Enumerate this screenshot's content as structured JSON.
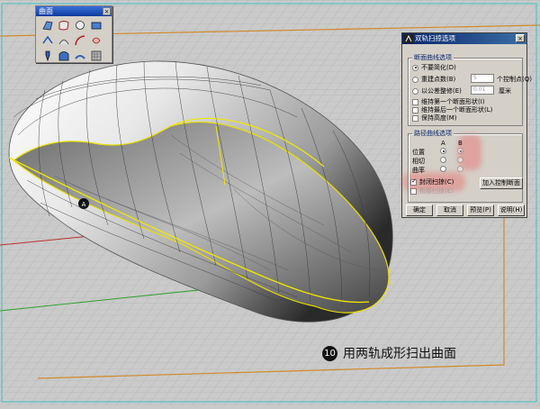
{
  "toolbar": {
    "title": "曲面",
    "icons": [
      "corner-points-surface-icon",
      "edge-curves-surface-icon",
      "planar-curves-surface-icon",
      "rectangle-plane-icon",
      "extrude-icon",
      "loft-icon",
      "sweep-rail-icon",
      "revolve-icon",
      "patch-icon",
      "network-surface-icon",
      "blend-icon",
      "drape-icon"
    ]
  },
  "dialog": {
    "title": "双轨扫掠选项",
    "section_cross": "断面曲线选项",
    "opt_no_simplify": "不要简化(D)",
    "opt_rebuild": "重建点数(B)",
    "rebuild_value": "5",
    "rebuild_unit": "个控制点(Q)",
    "opt_refit": "以公差整修(E)",
    "refit_value": "0.01",
    "refit_unit": "厘米",
    "chk_first": "维持第一个断面形状(I)",
    "chk_last": "维持最后一个断面形状(L)",
    "chk_height": "保持高度(M)",
    "section_path": "路径曲线选项",
    "col_a": "A",
    "col_b": "B",
    "row_position": "位置",
    "row_tangent": "相切",
    "row_curvature": "曲率",
    "chk_closed": "封闭扫掠(C)",
    "chk_seamless": "衔接扫掠(E)",
    "btn_add_section": "加入控制断面",
    "btn_ok": "确定",
    "btn_cancel": "取消",
    "btn_preview": "预览(P)",
    "btn_help": "说明(H)"
  },
  "caption": {
    "number": "10",
    "text": "用两轨成形扫出曲面"
  }
}
